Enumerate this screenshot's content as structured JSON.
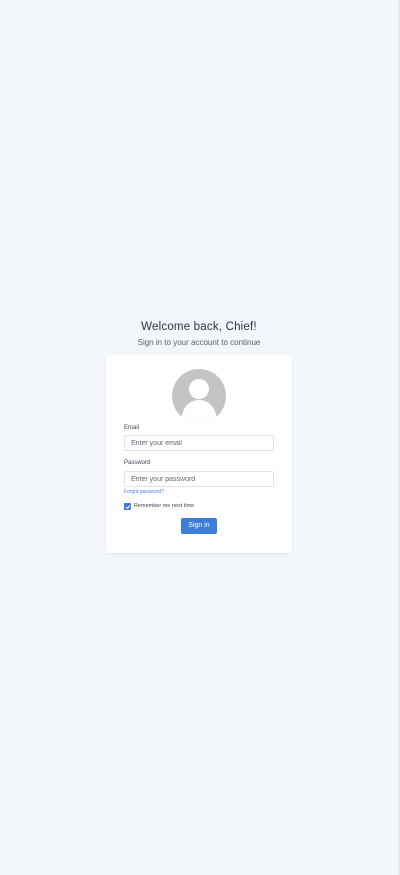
{
  "header": {
    "title": "Welcome back, Chief!",
    "subtitle": "Sign in to your account to continue"
  },
  "form": {
    "avatar_icon": "user-avatar-placeholder-icon",
    "email_label": "Email",
    "email_placeholder": "Enter your email",
    "password_label": "Password",
    "password_placeholder": "Enter your password",
    "forgot_link": "Forgot password?",
    "remember_label": "Remember me next time",
    "remember_checked": true,
    "signin_label": "Sign in"
  },
  "colors": {
    "background": "#f3f6fb",
    "accent": "#3b7dd8",
    "card": "#ffffff",
    "avatar": "#c4c4c4"
  }
}
